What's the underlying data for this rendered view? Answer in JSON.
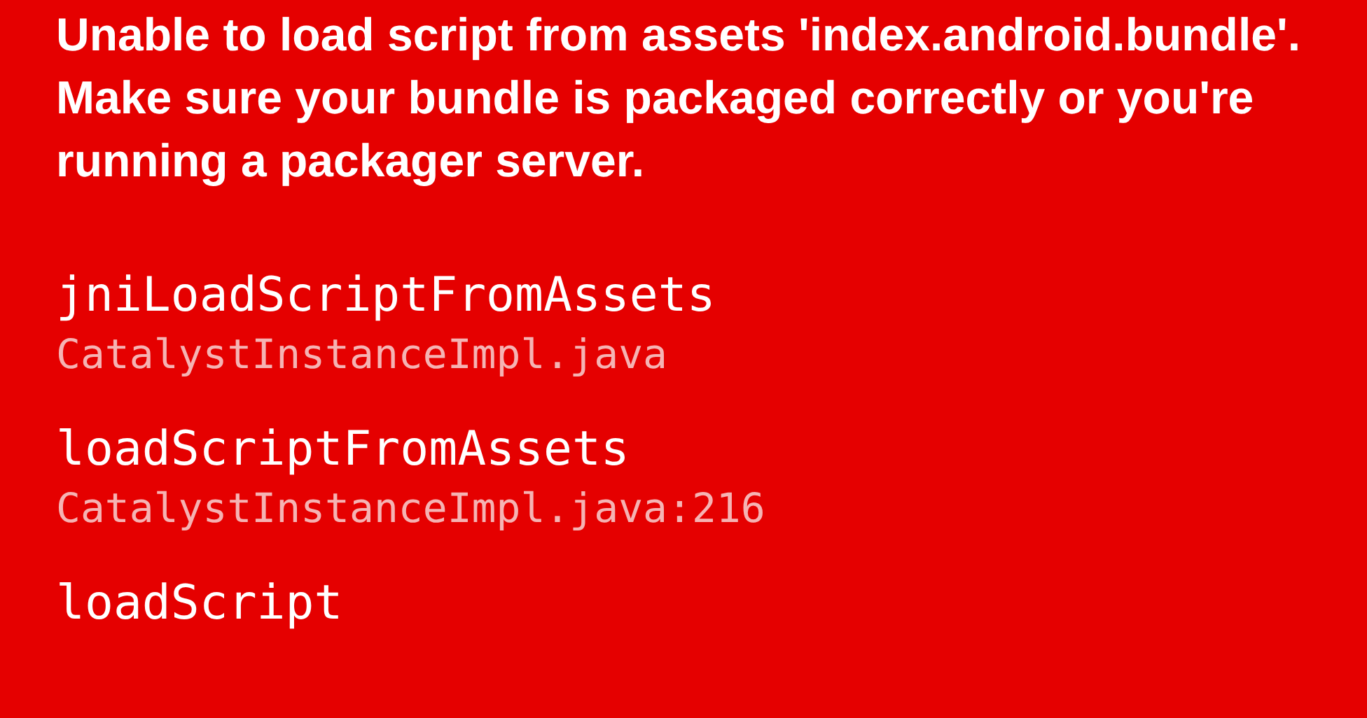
{
  "error_message": "Unable to load script from assets 'index.android.bundle'. Make sure your bundle is packaged correctly or you're running a packager server.",
  "stack_frames": [
    {
      "method": "jniLoadScriptFromAssets",
      "location": "CatalystInstanceImpl.java"
    },
    {
      "method": "loadScriptFromAssets",
      "location": "CatalystInstanceImpl.java:216"
    },
    {
      "method": "loadScript"
    }
  ]
}
